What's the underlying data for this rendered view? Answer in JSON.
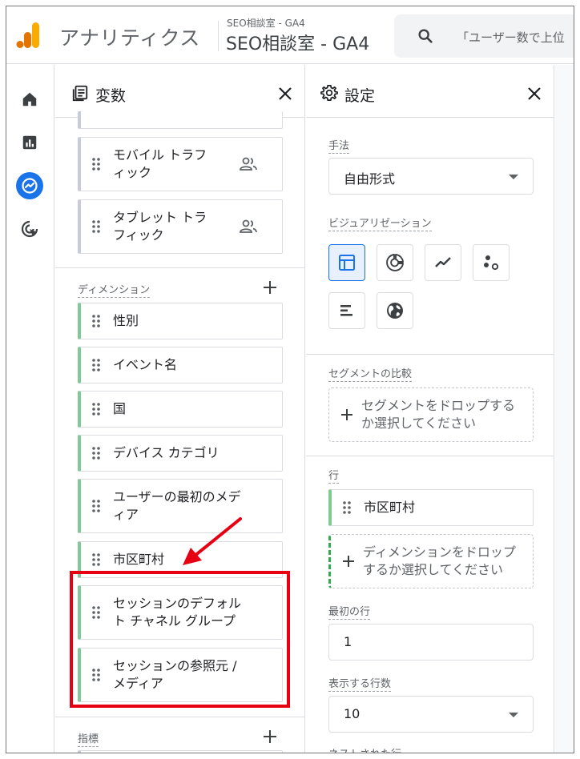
{
  "header": {
    "app_title": "アナリティクス",
    "account_small": "SEO相談室 - GA4",
    "account_big": "SEO相談室 - GA4",
    "search_placeholder": "「ユーザー数で上位"
  },
  "rail": {
    "items": [
      {
        "icon": "home-icon"
      },
      {
        "icon": "reports-icon"
      },
      {
        "icon": "explore-icon",
        "active": true
      },
      {
        "icon": "advertising-icon"
      }
    ]
  },
  "variables": {
    "title": "変数",
    "segment_items": [
      {
        "label": "モバイル トラフ\nィック"
      },
      {
        "label": "タブレット トラ\nフィック"
      }
    ],
    "dimensions_label": "ディメンション",
    "dimensions": [
      {
        "label": "性別"
      },
      {
        "label": "イベント名"
      },
      {
        "label": "国"
      },
      {
        "label": "デバイス カテゴリ"
      },
      {
        "label": "ユーザーの最初のメデ\nィア"
      },
      {
        "label": "市区町村"
      },
      {
        "label": "セッションのデフォル\nト チャネル グループ"
      },
      {
        "label": "セッションの参照元 /\nメディア"
      }
    ],
    "metrics_label": "指標"
  },
  "settings": {
    "title": "設定",
    "technique_label": "手法",
    "technique_value": "自由形式",
    "visualization_label": "ビジュアリゼーション",
    "segment_compare_label": "セグメントの比較",
    "segment_drop_text": "セグメントをドロップする\nか選択してください",
    "rows_label": "行",
    "rows_item": "市区町村",
    "rows_drop_text": "ディメンションをドロップ\nするか選択してください",
    "first_row_label": "最初の行",
    "first_row_value": "1",
    "show_rows_label": "表示する行数",
    "show_rows_value": "10",
    "nested_rows_label": "ネストされた行"
  },
  "colors": {
    "accent": "#1a73e8",
    "logo_orange": "#f9ab00",
    "logo_dark_orange": "#e37400",
    "dimension_green": "#81c995",
    "annotation_red": "#e60012"
  }
}
